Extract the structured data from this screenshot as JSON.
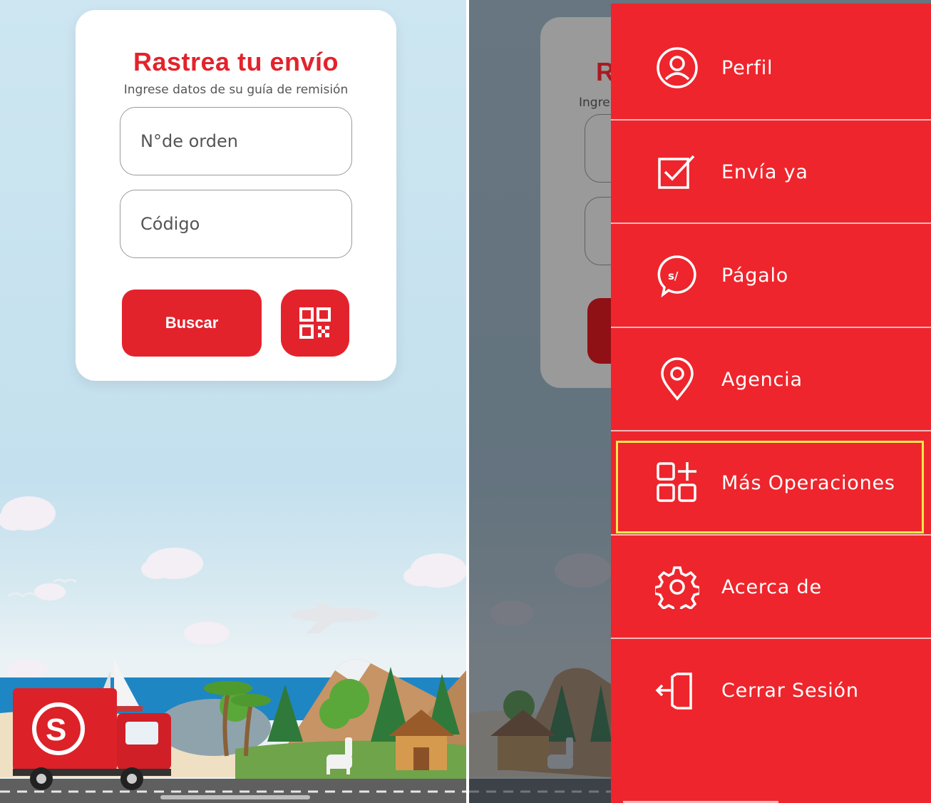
{
  "left": {
    "card": {
      "title": "Rastrea tu envío",
      "subtitle": "Ingrese datos de su guía de remisión",
      "order_placeholder": "N°de orden",
      "code_placeholder": "Código",
      "search_label": "Buscar"
    }
  },
  "right": {
    "background": {
      "title_fragment": "R",
      "subtitle_fragment": "Ingre"
    },
    "menu": {
      "items": [
        {
          "label": "Perfil",
          "icon": "user-circle-icon"
        },
        {
          "label": "Envía ya",
          "icon": "checkbox-icon"
        },
        {
          "label": "Págalo",
          "icon": "soles-bubble-icon"
        },
        {
          "label": "Agencia",
          "icon": "location-pin-icon"
        },
        {
          "label": "Más Operaciones",
          "icon": "grid-plus-icon",
          "highlighted": true
        },
        {
          "label": "Acerca de",
          "icon": "gear-icon"
        },
        {
          "label": "Cerrar Sesión",
          "icon": "logout-icon"
        }
      ]
    }
  },
  "colors": {
    "brand_red": "#e3232c",
    "drawer_red": "#ee252c",
    "highlight": "#f2e84a"
  }
}
